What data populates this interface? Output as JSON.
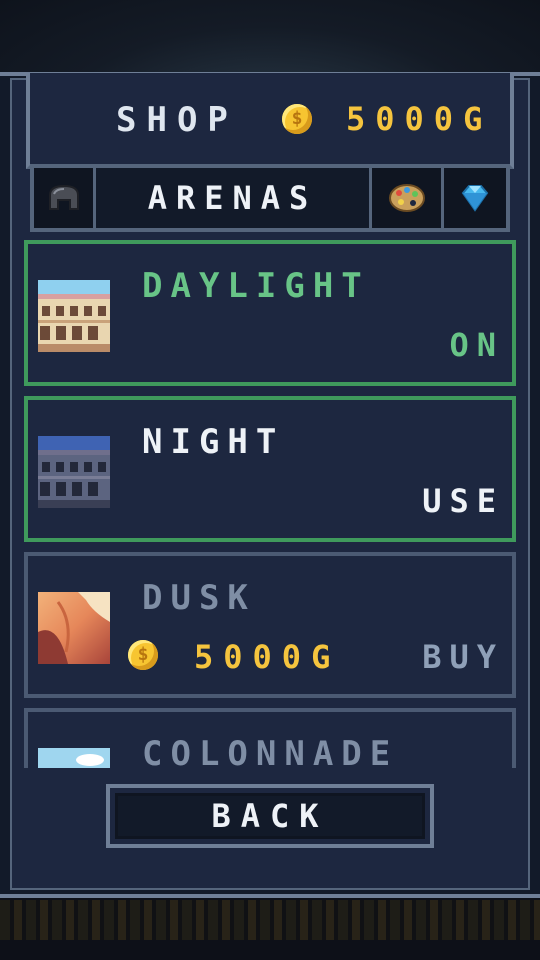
{
  "header": {
    "title": "SHOP",
    "balance": "5000G",
    "coin_icon": "gold-coin-icon"
  },
  "tabs": [
    {
      "id": "tab-armor",
      "icon": "helmet-icon",
      "active": false
    },
    {
      "id": "tab-arenas",
      "label": "ARENAS",
      "active": true
    },
    {
      "id": "tab-paint",
      "icon": "paint-palette-icon",
      "active": false
    },
    {
      "id": "tab-gems",
      "icon": "diamond-icon",
      "active": false
    }
  ],
  "arenas": [
    {
      "name": "DAYLIGHT",
      "status": "ON",
      "state": "owned-active"
    },
    {
      "name": "NIGHT",
      "status": "USE",
      "state": "owned"
    },
    {
      "name": "DUSK",
      "price": "5000G",
      "status": "BUY",
      "state": "locked"
    },
    {
      "name": "COLONNADE",
      "state": "locked"
    }
  ],
  "footer": {
    "back_label": "BACK"
  },
  "colors": {
    "panel": "#1d2740",
    "border": "#6f7f97",
    "owned_border": "#3f9a5c",
    "owned_text": "#68c487",
    "gold": "#f5c43e",
    "text": "#eef2f7",
    "muted_text": "#7f8ea5"
  }
}
